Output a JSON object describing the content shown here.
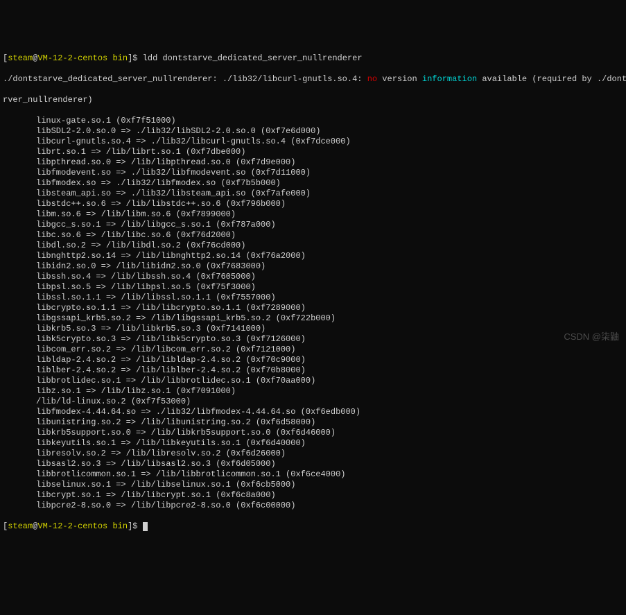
{
  "prompt1": {
    "user": "steam",
    "host": "VM-12-2-centos",
    "dir": "bin",
    "cmd": "ldd dontstarve_dedicated_server_nullrenderer"
  },
  "warning": {
    "prefix": "./dontstarve_dedicated_server_nullrenderer: ./lib32/libcurl-gnutls.so.4: ",
    "no": "no",
    "mid": " version ",
    "info": "information",
    "suffix": " available (required by ./dontstarve_dedicated_se",
    "cont": "rver_nullrenderer)"
  },
  "libs": [
    "linux-gate.so.1 (0xf7f51000)",
    "libSDL2-2.0.so.0 => ./lib32/libSDL2-2.0.so.0 (0xf7e6d000)",
    "libcurl-gnutls.so.4 => ./lib32/libcurl-gnutls.so.4 (0xf7dce000)",
    "librt.so.1 => /lib/librt.so.1 (0xf7dbe000)",
    "libpthread.so.0 => /lib/libpthread.so.0 (0xf7d9e000)",
    "libfmodevent.so => ./lib32/libfmodevent.so (0xf7d11000)",
    "libfmodex.so => ./lib32/libfmodex.so (0xf7b5b000)",
    "libsteam_api.so => ./lib32/libsteam_api.so (0xf7afe000)",
    "libstdc++.so.6 => /lib/libstdc++.so.6 (0xf796b000)",
    "libm.so.6 => /lib/libm.so.6 (0xf7899000)",
    "libgcc_s.so.1 => /lib/libgcc_s.so.1 (0xf787a000)",
    "libc.so.6 => /lib/libc.so.6 (0xf76d2000)",
    "libdl.so.2 => /lib/libdl.so.2 (0xf76cd000)",
    "libnghttp2.so.14 => /lib/libnghttp2.so.14 (0xf76a2000)",
    "libidn2.so.0 => /lib/libidn2.so.0 (0xf7683000)",
    "libssh.so.4 => /lib/libssh.so.4 (0xf7605000)",
    "libpsl.so.5 => /lib/libpsl.so.5 (0xf75f3000)",
    "libssl.so.1.1 => /lib/libssl.so.1.1 (0xf7557000)",
    "libcrypto.so.1.1 => /lib/libcrypto.so.1.1 (0xf7289000)",
    "libgssapi_krb5.so.2 => /lib/libgssapi_krb5.so.2 (0xf722b000)",
    "libkrb5.so.3 => /lib/libkrb5.so.3 (0xf7141000)",
    "libk5crypto.so.3 => /lib/libk5crypto.so.3 (0xf7126000)",
    "libcom_err.so.2 => /lib/libcom_err.so.2 (0xf7121000)",
    "libldap-2.4.so.2 => /lib/libldap-2.4.so.2 (0xf70c9000)",
    "liblber-2.4.so.2 => /lib/liblber-2.4.so.2 (0xf70b8000)",
    "libbrotlidec.so.1 => /lib/libbrotlidec.so.1 (0xf70aa000)",
    "libz.so.1 => /lib/libz.so.1 (0xf7091000)",
    "/lib/ld-linux.so.2 (0xf7f53000)",
    "libfmodex-4.44.64.so => ./lib32/libfmodex-4.44.64.so (0xf6edb000)",
    "libunistring.so.2 => /lib/libunistring.so.2 (0xf6d58000)",
    "libkrb5support.so.0 => /lib/libkrb5support.so.0 (0xf6d46000)",
    "libkeyutils.so.1 => /lib/libkeyutils.so.1 (0xf6d40000)",
    "libresolv.so.2 => /lib/libresolv.so.2 (0xf6d26000)",
    "libsasl2.so.3 => /lib/libsasl2.so.3 (0xf6d05000)",
    "libbrotlicommon.so.1 => /lib/libbrotlicommon.so.1 (0xf6ce4000)",
    "libselinux.so.1 => /lib/libselinux.so.1 (0xf6cb5000)",
    "libcrypt.so.1 => /lib/libcrypt.so.1 (0xf6c8a000)",
    "libpcre2-8.so.0 => /lib/libpcre2-8.so.0 (0xf6c00000)"
  ],
  "prompt2": {
    "user": "steam",
    "host": "VM-12-2-centos",
    "dir": "bin"
  },
  "watermark": "CSDN @柒鼬"
}
